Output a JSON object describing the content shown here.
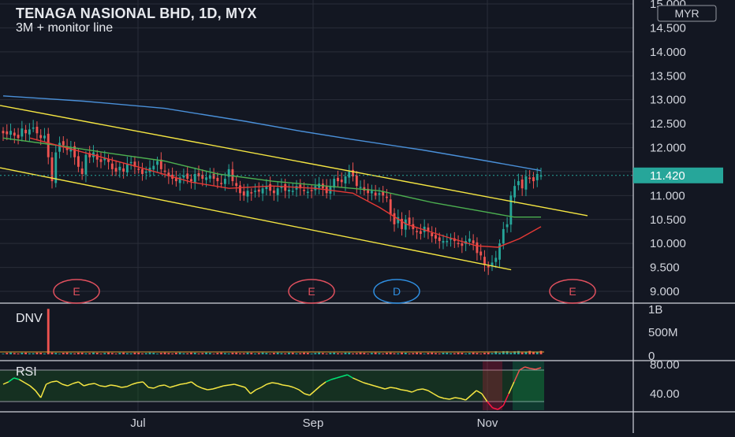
{
  "header": {
    "title": "TENAGA NASIONAL BHD, 1D, MYX",
    "subtitle": "3M + monitor line",
    "currency_badge": "MYR"
  },
  "colors": {
    "background": "#131722",
    "grid": "#2a2e39",
    "axis_text": "#d1d4dc",
    "up_candle": "#26a69a",
    "down_candle": "#ef5350",
    "channel_line": "#f5e642",
    "ma_blue": "#4a90d9",
    "ma_green": "#4caf50",
    "ma_red": "#e53935",
    "rsi_line": "#f5e642",
    "rsi_high": "#00e676",
    "rsi_low": "#ff1744",
    "price_badge": "#26a69a",
    "event_circle_red": "#e0505e",
    "event_circle_blue": "#2f8ee0"
  },
  "chart_data": [
    {
      "type": "candlestick",
      "title": "TENAGA NASIONAL BHD, 1D, MYX",
      "ylim": [
        9.0,
        15.0
      ],
      "yticks": [
        "15.000",
        "14.500",
        "14.000",
        "13.500",
        "13.000",
        "12.500",
        "12.000",
        "11.500",
        "11.000",
        "10.500",
        "10.000",
        "9.500",
        "9.000"
      ],
      "x_tick_labels": [
        "Jul",
        "Sep",
        "Nov"
      ],
      "last_price": "11.420",
      "close_series": [
        12.3,
        12.28,
        12.35,
        12.25,
        12.2,
        12.4,
        12.3,
        12.38,
        12.42,
        12.3,
        12.2,
        12.25,
        11.8,
        11.3,
        11.9,
        12.1,
        12.05,
        11.95,
        12.0,
        11.8,
        11.6,
        11.45,
        11.85,
        11.8,
        11.9,
        11.75,
        11.7,
        11.78,
        11.7,
        11.55,
        11.5,
        11.6,
        11.5,
        11.65,
        11.7,
        11.6,
        11.55,
        11.45,
        11.5,
        11.58,
        11.62,
        11.72,
        11.55,
        11.5,
        11.4,
        11.35,
        11.3,
        11.38,
        11.42,
        11.35,
        11.3,
        11.45,
        11.4,
        11.35,
        11.38,
        11.42,
        11.35,
        11.3,
        11.25,
        11.35,
        11.55,
        11.3,
        11.2,
        11.05,
        11.0,
        11.1,
        11.05,
        11.1,
        11.08,
        11.15,
        11.2,
        11.1,
        11.05,
        11.15,
        11.2,
        11.1,
        11.12,
        11.1,
        11.2,
        11.15,
        11.1,
        11.08,
        11.1,
        11.2,
        11.25,
        11.15,
        11.05,
        11.2,
        11.35,
        11.3,
        11.28,
        11.4,
        11.5,
        11.4,
        11.2,
        11.18,
        11.1,
        11.05,
        11.1,
        11.0,
        11.05,
        11.0,
        10.95,
        10.6,
        10.4,
        10.55,
        10.3,
        10.5,
        10.4,
        10.3,
        10.25,
        10.2,
        10.35,
        10.25,
        10.15,
        10.1,
        10.05,
        10.05,
        10.05,
        10.1,
        10.05,
        10.0,
        9.95,
        10.05,
        10.1,
        10.0,
        9.8,
        9.75,
        9.55,
        9.5,
        9.6,
        9.7,
        10.0,
        10.3,
        10.4,
        11.0,
        11.2,
        11.3,
        11.15,
        11.4,
        11.35,
        11.3,
        11.45,
        11.42
      ],
      "moving_averages": [
        {
          "color": "blue",
          "points": [
            [
              0,
              13.08
            ],
            [
              0.15,
              12.97
            ],
            [
              0.3,
              12.82
            ],
            [
              0.45,
              12.55
            ],
            [
              0.55,
              12.35
            ],
            [
              0.65,
              12.17
            ],
            [
              0.78,
              11.95
            ],
            [
              0.9,
              11.72
            ],
            [
              1.0,
              11.52
            ]
          ]
        },
        {
          "color": "green",
          "points": [
            [
              0,
              12.2
            ],
            [
              0.1,
              12.05
            ],
            [
              0.2,
              11.88
            ],
            [
              0.3,
              11.72
            ],
            [
              0.4,
              11.45
            ],
            [
              0.5,
              11.3
            ],
            [
              0.6,
              11.2
            ],
            [
              0.7,
              11.1
            ],
            [
              0.8,
              10.85
            ],
            [
              0.9,
              10.65
            ],
            [
              0.95,
              10.55
            ],
            [
              1.0,
              10.55
            ]
          ]
        },
        {
          "color": "red",
          "points": [
            [
              0.05,
              12.2
            ],
            [
              0.15,
              11.9
            ],
            [
              0.25,
              11.6
            ],
            [
              0.35,
              11.28
            ],
            [
              0.42,
              11.15
            ],
            [
              0.5,
              11.2
            ],
            [
              0.58,
              11.15
            ],
            [
              0.65,
              11.05
            ],
            [
              0.7,
              10.75
            ],
            [
              0.75,
              10.4
            ],
            [
              0.82,
              10.15
            ],
            [
              0.88,
              9.95
            ],
            [
              0.92,
              9.92
            ],
            [
              0.96,
              10.1
            ],
            [
              1.0,
              10.35
            ]
          ]
        }
      ],
      "channel_lines": [
        {
          "from": [
            0.0,
            12.88
          ],
          "to": [
            1.0,
            10.58
          ]
        },
        {
          "from": [
            0.0,
            11.58
          ],
          "to": [
            0.87,
            9.45
          ]
        }
      ],
      "events": [
        {
          "label": "E",
          "kind": "earnings"
        },
        {
          "label": "E",
          "kind": "earnings"
        },
        {
          "label": "D",
          "kind": "dividend"
        },
        {
          "label": "E",
          "kind": "earnings"
        }
      ]
    },
    {
      "type": "bar",
      "title": "DNV",
      "yticks": [
        "1B",
        "500M",
        "0"
      ],
      "note": "volume histogram with a single large spike early in the period"
    },
    {
      "type": "line",
      "title": "RSI",
      "yticks": [
        "80.00",
        "40.00"
      ],
      "levels": [
        70,
        30
      ],
      "values": [
        52,
        55,
        60,
        58,
        54,
        50,
        44,
        35,
        52,
        55,
        56,
        52,
        50,
        53,
        55,
        50,
        52,
        53,
        50,
        49,
        51,
        50,
        48,
        49,
        52,
        54,
        55,
        48,
        47,
        50,
        51,
        48,
        50,
        52,
        53,
        55,
        50,
        47,
        45,
        46,
        48,
        50,
        51,
        52,
        50,
        48,
        40,
        45,
        48,
        52,
        54,
        53,
        51,
        50,
        48,
        45,
        40,
        38,
        44,
        50,
        55,
        58,
        60,
        62,
        64,
        60,
        57,
        54,
        52,
        50,
        48,
        46,
        48,
        47,
        45,
        44,
        42,
        45,
        46,
        44,
        40,
        36,
        34,
        33,
        35,
        34,
        32,
        38,
        44,
        40,
        30,
        22,
        20,
        25,
        40,
        55,
        70,
        74,
        72,
        71,
        73
      ]
    }
  ]
}
